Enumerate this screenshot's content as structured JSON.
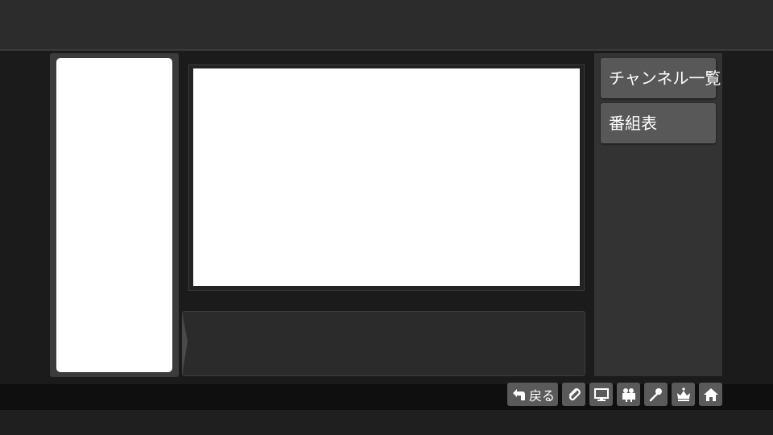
{
  "menu": {
    "channel_list_label": "チャンネル一覧",
    "program_guide_label": "番組表"
  },
  "toolbar": {
    "back_label": "戻る",
    "icons": [
      "back-arrow-icon",
      "paperclip-icon",
      "monitor-icon",
      "video-camera-icon",
      "microphone-icon",
      "crown-icon",
      "home-icon"
    ]
  },
  "colors": {
    "top_bar": "#2c2c2c",
    "background": "#1b1b1b",
    "button": "#585858",
    "panel": "#333333",
    "screen": "#ffffff"
  }
}
